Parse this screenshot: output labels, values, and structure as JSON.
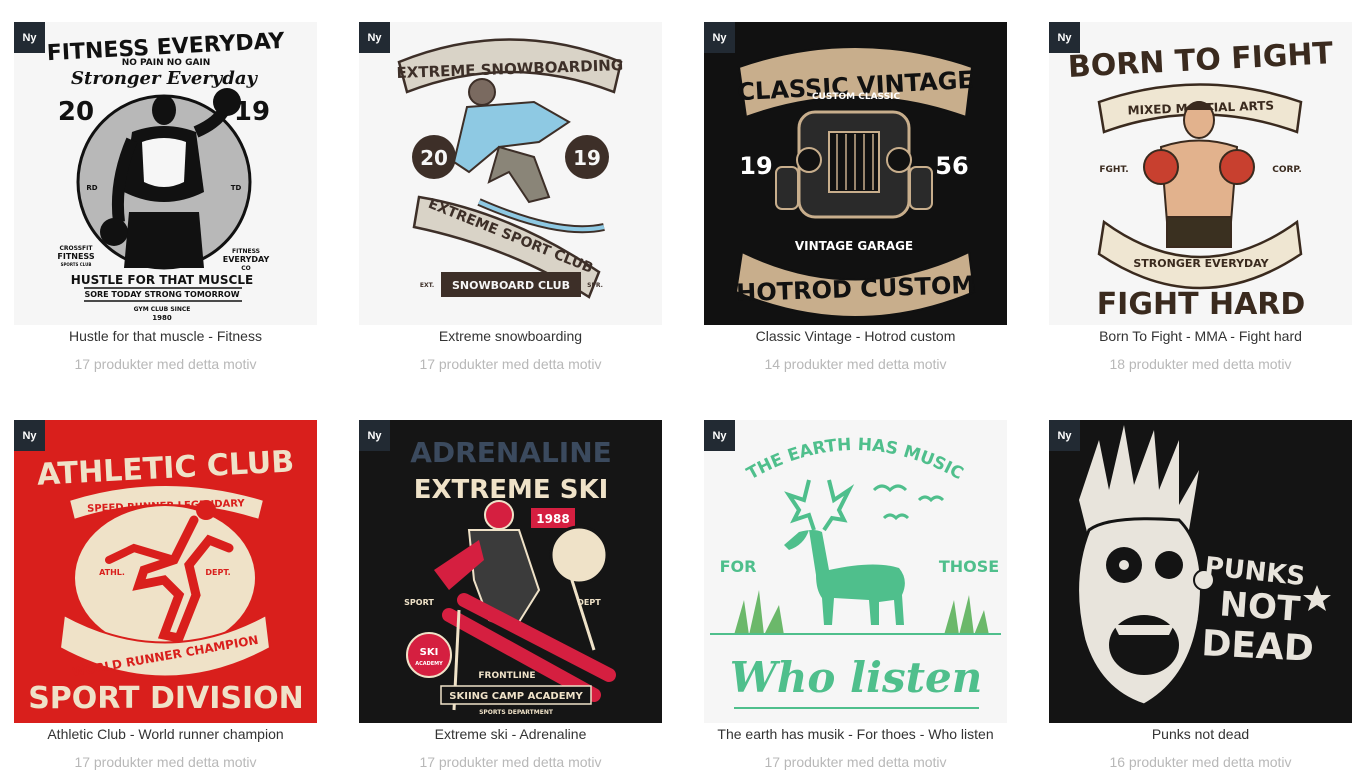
{
  "badge_label": "Ny",
  "products": [
    {
      "title": "Hustle for that muscle - Fitness",
      "count": "17 produkter med detta motiv",
      "art": {
        "line1": "FITNESS EVERYDAY",
        "line2": "NO PAIN NO GAIN",
        "line3": "Stronger Everyday",
        "year_left": "20",
        "year_right": "19",
        "rd": "RD",
        "td": "TD",
        "crossfit": "CROSSFIT",
        "fitness": "FITNESS",
        "sports_club": "SPORTS CLUB",
        "fitness_r": "FITNESS",
        "everyday_r": "EVERYDAY",
        "co": "CO",
        "slogan": "HUSTLE FOR THAT MUSCLE",
        "sub": "SORE TODAY STRONG TOMORROW",
        "gym": "GYM CLUB SINCE",
        "since": "1980"
      }
    },
    {
      "title": "Extreme snowboarding",
      "count": "17 produkter med detta motiv",
      "art": {
        "banner_top": "EXTREME SNOWBOARDING",
        "year_left": "20",
        "year_right": "19",
        "banner_mid": "EXTREME SPORT CLUB",
        "banner_low": "SNOWBOARD CLUB",
        "ext": "EXT.",
        "spr": "SPR."
      }
    },
    {
      "title": "Classic Vintage - Hotrod custom",
      "count": "14 produkter med detta motiv",
      "art": {
        "banner_top": "CLASSIC VINTAGE",
        "custom": "CUSTOM CLASSIC",
        "year_left": "19",
        "year_right": "56",
        "garage": "VINTAGE GARAGE",
        "banner_low": "HOTROD CUSTOM"
      }
    },
    {
      "title": "Born To Fight - MMA - Fight hard",
      "count": "18 produkter med detta motiv",
      "art": {
        "top": "BORN TO FIGHT",
        "banner": "MIXED MARTIAL ARTS",
        "left": "FGHT.",
        "right": "CORP.",
        "ribbon": "STRONGER EVERYDAY",
        "bottom": "FIGHT HARD"
      }
    },
    {
      "title": "Athletic Club - World runner champion",
      "count": "17 produkter med detta motiv",
      "art": {
        "top": "ATHLETIC CLUB",
        "banner": "SPEED RUNNER LEGENDARY",
        "left": "ATHL.",
        "right": "DEPT.",
        "ribbon": "WORLD RUNNER CHAMPION",
        "bottom": "SPORT DIVISION"
      }
    },
    {
      "title": "Extreme ski - Adrenaline",
      "count": "17 produkter med detta motiv",
      "art": {
        "top": "ADRENALINE",
        "second": "EXTREME SKI",
        "year": "1988",
        "sport": "SPORT",
        "dept": "DEPT",
        "ski": "SKI",
        "academy": "ACADEMY",
        "frontline": "FRONTLINE",
        "camp": "SKIING CAMP ACADEMY",
        "sports_dept": "SPORTS DEPARTMENT"
      }
    },
    {
      "title": "The earth has musik - For thoes - Who listen",
      "count": "17 produkter med detta motiv",
      "art": {
        "arc": "THE EARTH HAS MUSIC",
        "left": "FOR",
        "right": "THOSE",
        "script": "Who listen"
      }
    },
    {
      "title": "Punks not dead",
      "count": "16 produkter med detta motiv",
      "art": {
        "line1": "PUNKS",
        "line2": "NOT",
        "line3": "DEAD"
      }
    }
  ]
}
